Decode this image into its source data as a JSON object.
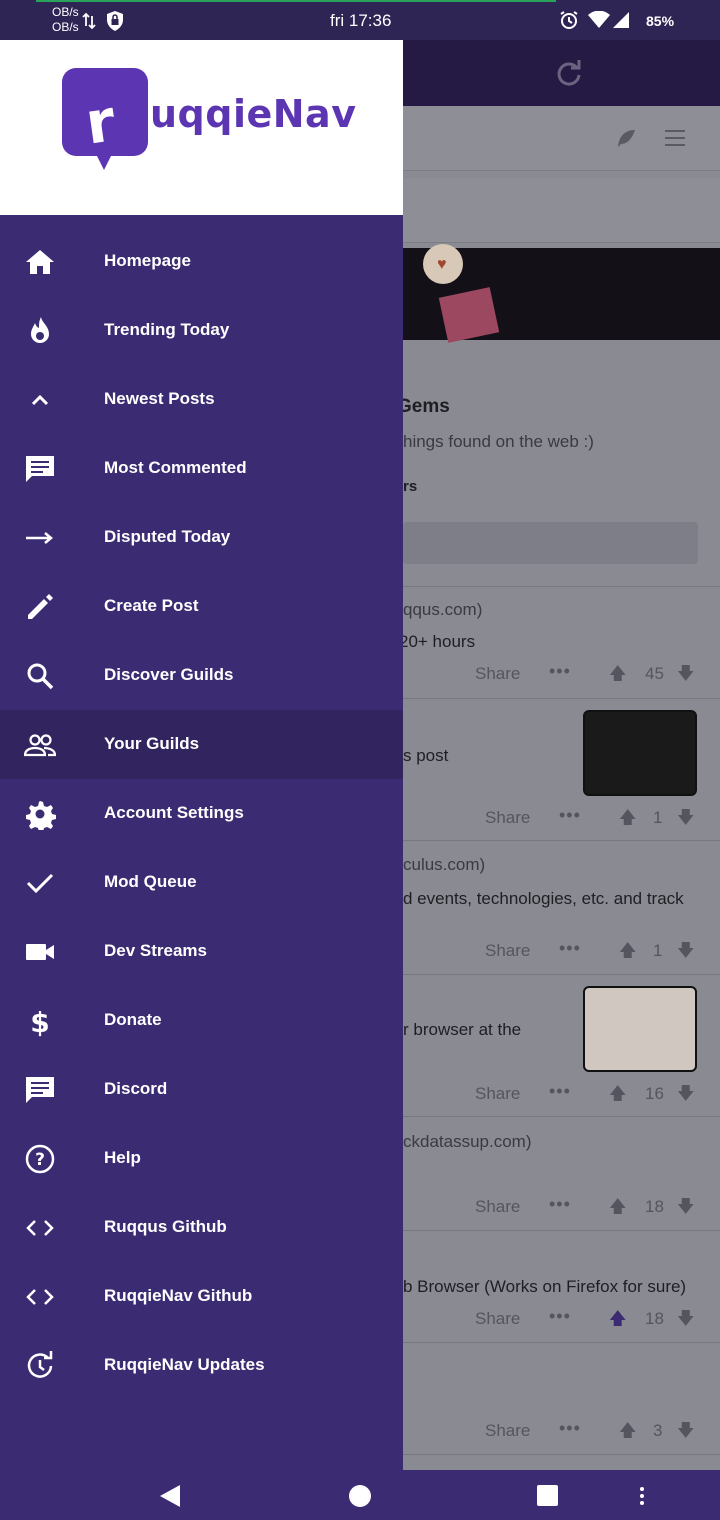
{
  "status_bar": {
    "net_up": "OB/s",
    "net_down": "OB/s",
    "time": "fri 17:36",
    "battery": "85%"
  },
  "drawer": {
    "app_name": "uqqieNav",
    "items": [
      {
        "label": "Homepage",
        "icon": "home-icon"
      },
      {
        "label": "Trending Today",
        "icon": "fire-icon"
      },
      {
        "label": "Newest Posts",
        "icon": "chevron-up-icon"
      },
      {
        "label": "Most Commented",
        "icon": "comment-icon"
      },
      {
        "label": "Disputed Today",
        "icon": "arrow-right-icon"
      },
      {
        "label": "Create Post",
        "icon": "pencil-icon"
      },
      {
        "label": "Discover Guilds",
        "icon": "search-icon"
      },
      {
        "label": "Your Guilds",
        "icon": "people-icon",
        "active": true
      },
      {
        "label": "Account Settings",
        "icon": "gear-icon"
      },
      {
        "label": "Mod Queue",
        "icon": "check-icon"
      },
      {
        "label": "Dev Streams",
        "icon": "video-camera-icon"
      },
      {
        "label": "Donate",
        "icon": "dollar-icon"
      },
      {
        "label": "Discord",
        "icon": "chat-icon"
      },
      {
        "label": "Help",
        "icon": "help-circle-icon"
      },
      {
        "label": "Ruqqus Github",
        "icon": "code-icon"
      },
      {
        "label": "RuqqieNav Github",
        "icon": "code-icon"
      },
      {
        "label": "RuqqieNav Updates",
        "icon": "update-icon"
      }
    ]
  },
  "background": {
    "guild_title": "Gems",
    "guild_desc": "hings found on the web :)",
    "guild_members": "rs",
    "posts": [
      {
        "domain": "qqus.com)",
        "title": "20+ hours",
        "share": "Share",
        "votes": "45"
      },
      {
        "title": "s post",
        "share": "Share",
        "votes": "1"
      },
      {
        "domain": "culus.com)",
        "title": "d events, technologies, etc. and track",
        "share": "Share",
        "votes": "1"
      },
      {
        "title": "r browser at the",
        "share": "Share",
        "votes": "16"
      },
      {
        "domain": "ckdatassup.com)",
        "share": "Share",
        "votes": "18"
      },
      {
        "title": "b Browser (Works on Firefox for sure)",
        "share": "Share",
        "votes": "18"
      },
      {
        "share": "Share",
        "votes": "3"
      }
    ]
  },
  "colors": {
    "drawer_bg": "#3b2b72",
    "brand": "#5c35b3",
    "active_item": "#32255f"
  }
}
